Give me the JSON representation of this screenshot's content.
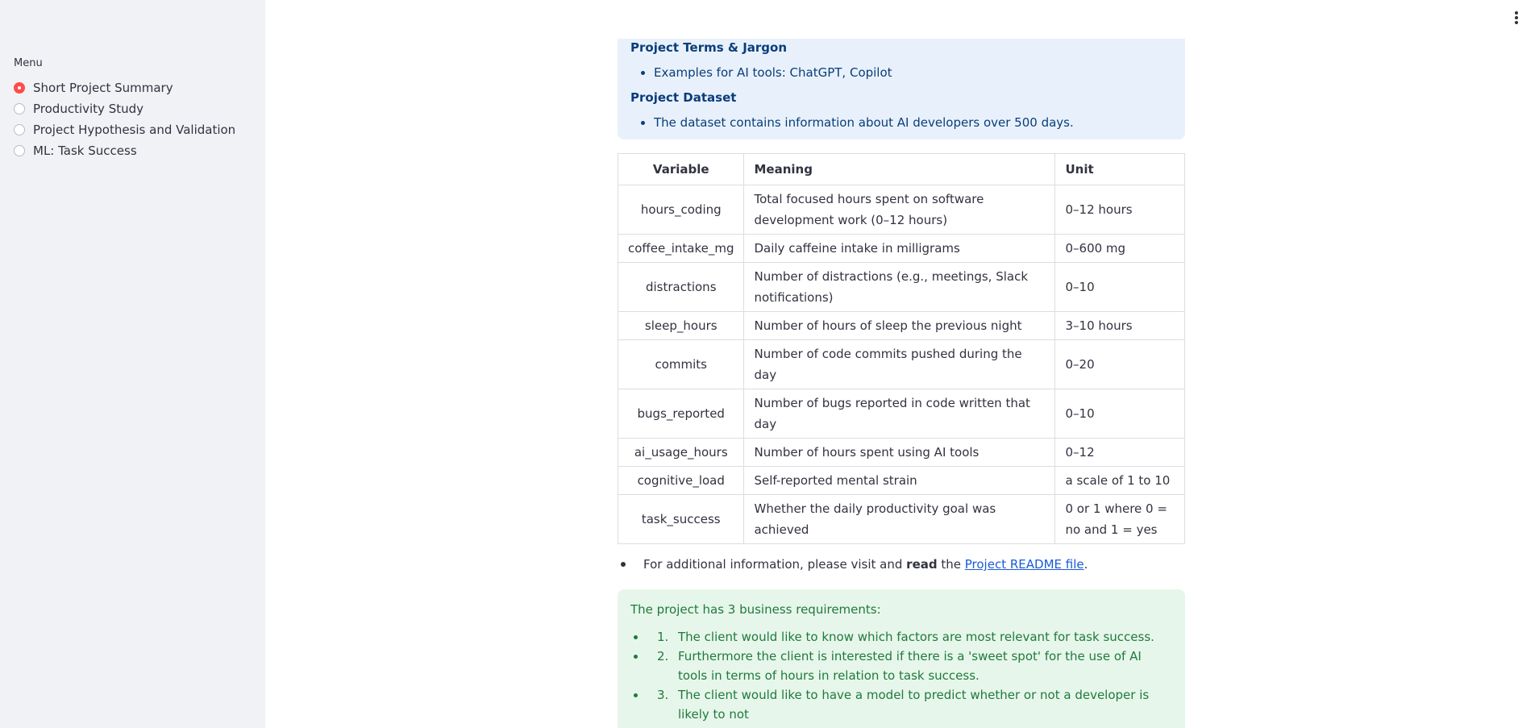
{
  "sidebar": {
    "menu_label": "Menu",
    "items": [
      {
        "label": "Short Project Summary",
        "selected": true
      },
      {
        "label": "Productivity Study",
        "selected": false
      },
      {
        "label": "Project Hypothesis and Validation",
        "selected": false
      },
      {
        "label": "ML: Task Success",
        "selected": false
      }
    ]
  },
  "colors": {
    "accent": "#ff4b4b",
    "info_bg": "#e8f1fb",
    "info_text": "#0a3d7a",
    "success_bg": "#e7f6ea",
    "success_text": "#1f7a3d",
    "link": "#1a5bd6"
  },
  "main": {
    "info": {
      "terms_heading": "Project Terms & Jargon",
      "terms_items": [
        "Examples for AI tools: ChatGPT, Copilot"
      ],
      "dataset_heading": "Project Dataset",
      "dataset_items": [
        "The dataset contains information about AI developers over 500 days."
      ]
    },
    "table": {
      "headers": [
        "Variable",
        "Meaning",
        "Unit"
      ],
      "rows": [
        [
          "hours_coding",
          "Total focused hours spent on software development work (0–12 hours)",
          "0–12 hours"
        ],
        [
          "coffee_intake_mg",
          "Daily caffeine intake in milligrams",
          "0–600 mg"
        ],
        [
          "distractions",
          "Number of distractions (e.g., meetings, Slack notifications)",
          "0–10"
        ],
        [
          "sleep_hours",
          "Number of hours of sleep the previous night",
          "3–10 hours"
        ],
        [
          "commits",
          "Number of code commits pushed during the day",
          "0–20"
        ],
        [
          "bugs_reported",
          "Number of bugs reported in code written that day",
          "0–10"
        ],
        [
          "ai_usage_hours",
          "Number of hours spent using AI tools",
          "0–12"
        ],
        [
          "cognitive_load",
          "Self-reported mental strain",
          "a scale of 1 to 10"
        ],
        [
          "task_success",
          "Whether the daily productivity goal was achieved",
          "0 or 1 where 0 = no and 1 = yes"
        ]
      ]
    },
    "readme": {
      "prefix": "For additional information, please visit and ",
      "bold": "read",
      "middle": " the ",
      "link": "Project README file",
      "suffix": "."
    },
    "requirements": {
      "intro": "The project has 3 business requirements:",
      "items": [
        {
          "num": "1.",
          "text": "The client would like to know which factors are most relevant for task success."
        },
        {
          "num": "2.",
          "text": "Furthermore the client is interested if there is a 'sweet spot' for the use of AI tools in terms of hours in relation to task success."
        },
        {
          "num": "3.",
          "text": "The client would like to have a model to predict whether or not a developer is likely to not"
        }
      ]
    }
  }
}
